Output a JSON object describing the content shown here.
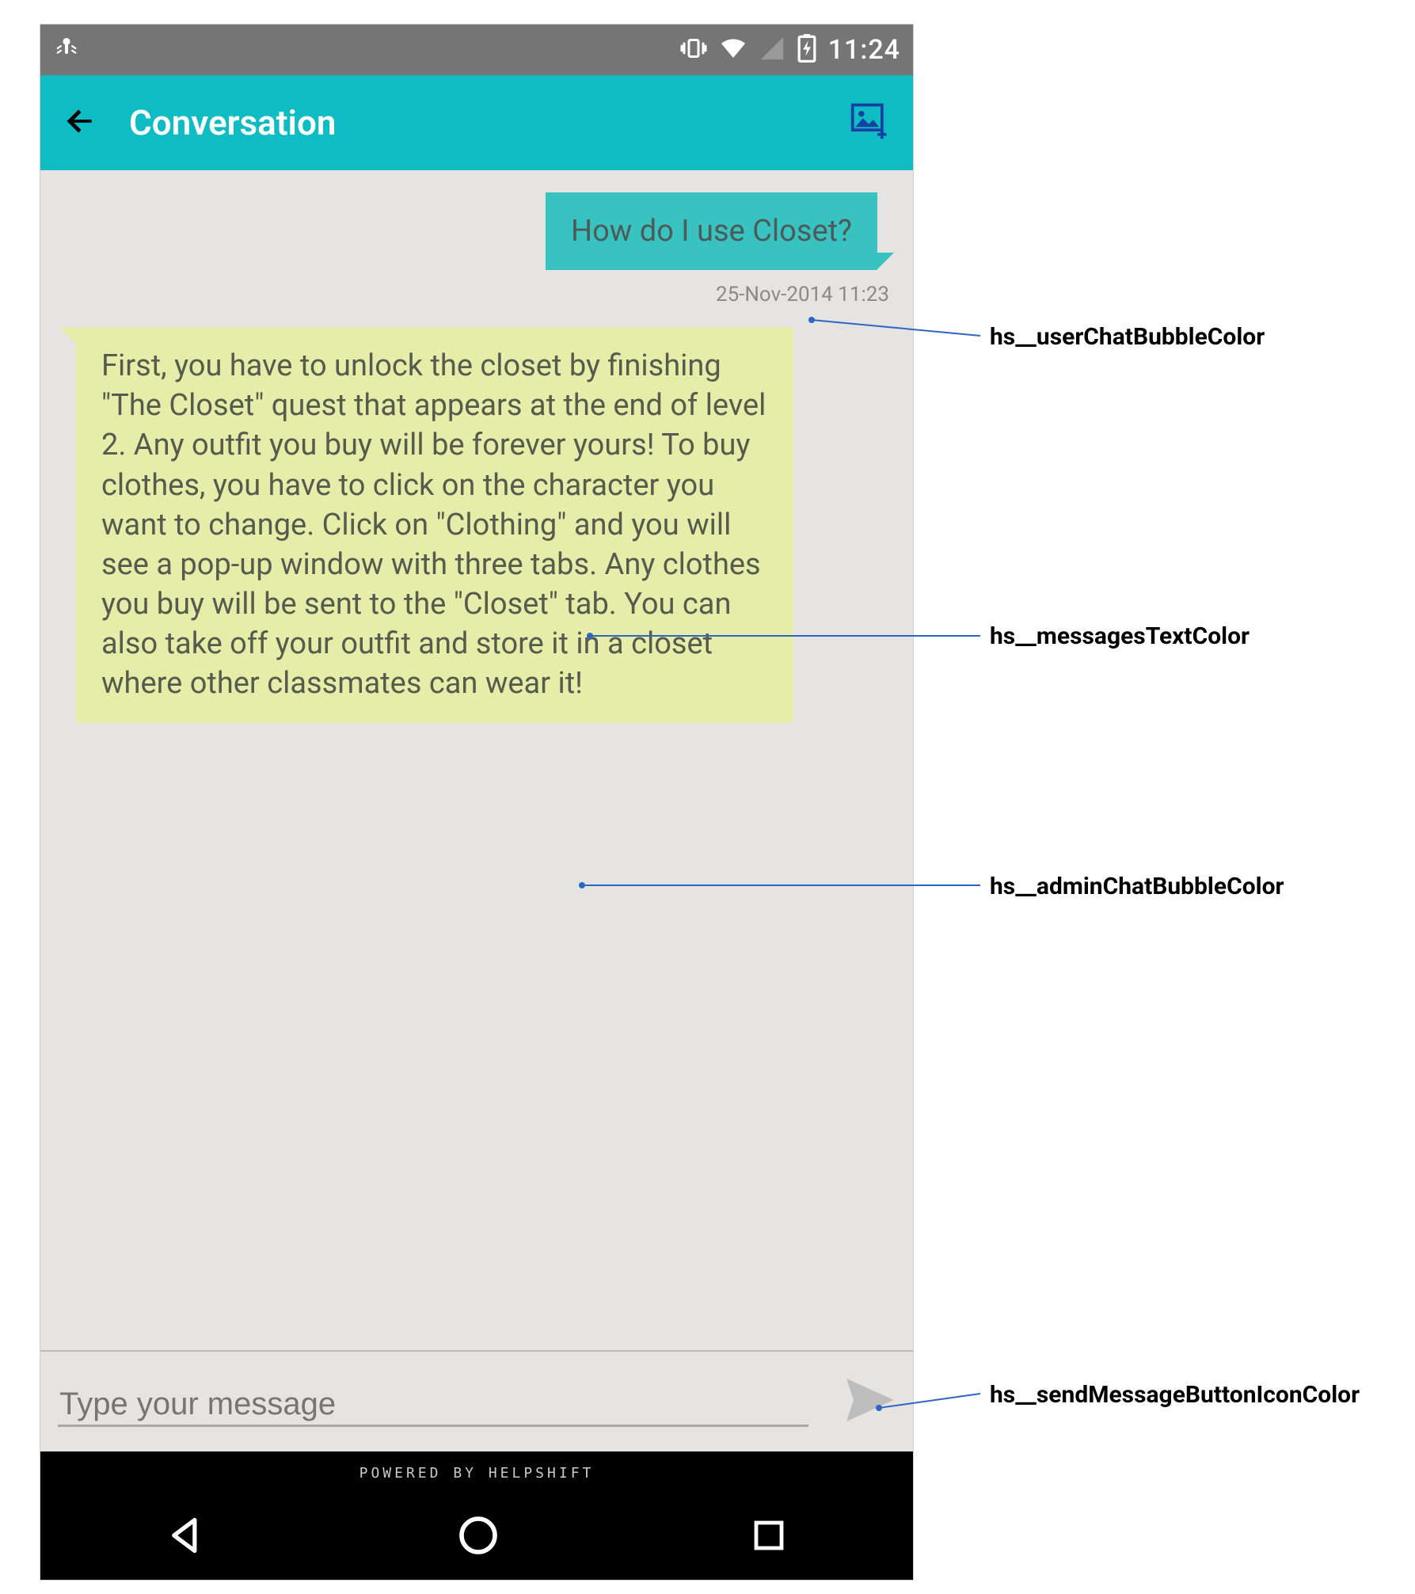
{
  "status_bar": {
    "time": "11:24"
  },
  "app_bar": {
    "title": "Conversation"
  },
  "chat": {
    "user_message": "How do I use Closet?",
    "user_timestamp": "25-Nov-2014 11:23",
    "admin_message": "First, you have to unlock the closet by finishing \"The Closet\" quest that appears at the end of level 2. Any outfit you buy will be forever yours! To buy clothes, you have to click on the character you want to change. Click on \"Clothing\" and you will see a pop-up window with three tabs. Any clothes you buy will be sent to the \"Closet\" tab. You can also take off your outfit and store it in a closet where other classmates can wear it!"
  },
  "input": {
    "placeholder": "Type your message"
  },
  "footer": {
    "powered_by": "POWERED BY HELPSHIFT"
  },
  "annotations": {
    "user_bubble": "hs__userChatBubbleColor",
    "messages_text": "hs__messagesTextColor",
    "admin_bubble": "hs__adminChatBubbleColor",
    "send_icon": "hs__sendMessageButtonIconColor"
  },
  "colors": {
    "userChatBubble": "#39c3c0",
    "adminChatBubble": "#e5eda8",
    "messagesText": "#565b4d",
    "sendIcon": "#bdbdbd",
    "appBar": "#10bcc3"
  }
}
